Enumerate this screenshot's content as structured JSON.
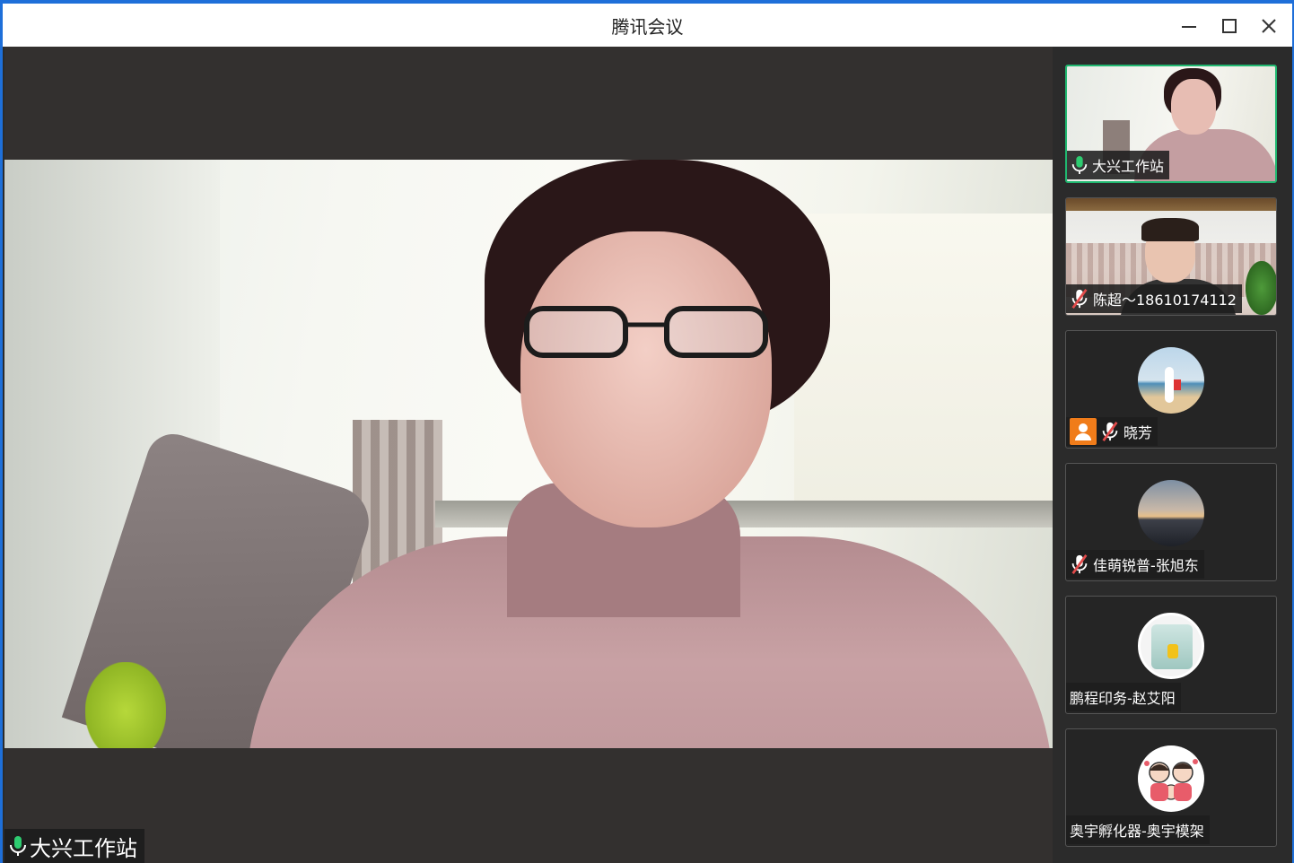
{
  "window": {
    "title": "腾讯会议"
  },
  "main_speaker": {
    "name": "大兴工作站",
    "mic": "on"
  },
  "participants": [
    {
      "name": "大兴工作站",
      "mic": "on",
      "video": true,
      "active": true
    },
    {
      "name": "陈超～18610174112",
      "mic": "muted",
      "video": true,
      "active": false
    },
    {
      "name": "晓芳",
      "mic": "muted",
      "video": false,
      "active": false,
      "avatar": "beach-photo"
    },
    {
      "name": "佳萌锐普-张旭东",
      "mic": "muted",
      "video": false,
      "active": false,
      "avatar": "sunset-photo"
    },
    {
      "name": "鹏程印务-赵艾阳",
      "mic": "none",
      "video": false,
      "active": false,
      "avatar": "child-photo"
    },
    {
      "name": "奥宇孵化器-奥宇模架",
      "mic": "none",
      "video": false,
      "active": false,
      "avatar": "family-cartoon"
    }
  ],
  "colors": {
    "accent": "#20b870",
    "host_icon": "#f07c1a",
    "muted": "#e24b4b"
  }
}
